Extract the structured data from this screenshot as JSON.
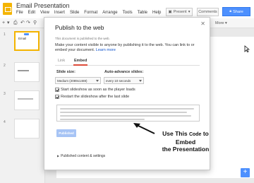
{
  "header": {
    "doc_title": "Email Presentation",
    "menu": [
      "File",
      "Edit",
      "View",
      "Insert",
      "Slide",
      "Format",
      "Arrange",
      "Tools",
      "Table",
      "Help",
      "L..."
    ],
    "present_label": "Present",
    "comments_label": "Comments",
    "share_label": "Share",
    "user_name": "",
    "more_label": "More"
  },
  "filmstrip": {
    "slide_numbers": [
      "1",
      "2",
      "3",
      "4"
    ],
    "slide_1_title": "Email"
  },
  "dialog": {
    "title": "Publish to the web",
    "published_note": "This document is published to the web.",
    "description": "Make your content visible to anyone by publishing it to the web. You can link to or embed your document.",
    "learn_more": "Learn more",
    "tabs": {
      "link": "Link",
      "embed": "Embed"
    },
    "slide_size_label": "Slide size:",
    "slide_size_value": "Medium (2089x1469)",
    "advance_label": "Auto-advance slides:",
    "advance_value": "every 10 seconds",
    "start_label": "Start slideshow as soon as the player loads",
    "restart_label": "Restart the slideshow after the last slide",
    "published_button": "Published",
    "published_settings": "Published content & settings"
  },
  "annotation": {
    "line1_a": "Use This",
    "line1_b": "Code",
    "line1_c": "to Embed",
    "line2": "the Presentation"
  },
  "colors": {
    "accent": "#4d90fe",
    "tab_underline": "#dd4b39",
    "logo": "#f4b400"
  }
}
